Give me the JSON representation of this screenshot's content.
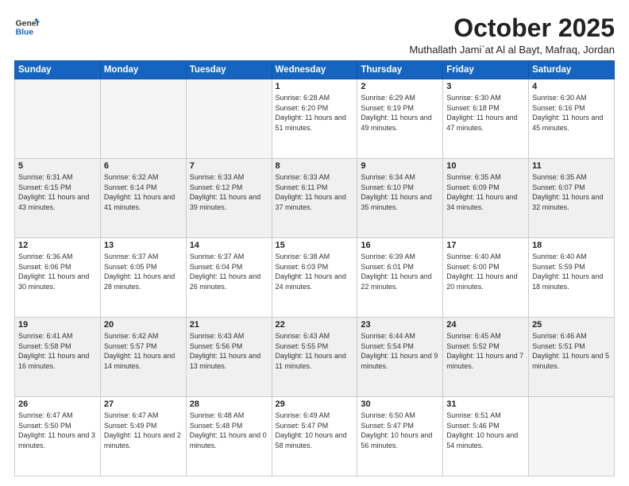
{
  "header": {
    "logo_general": "General",
    "logo_blue": "Blue",
    "month": "October 2025",
    "location": "Muthallath Jami`at Al al Bayt, Mafraq, Jordan"
  },
  "weekdays": [
    "Sunday",
    "Monday",
    "Tuesday",
    "Wednesday",
    "Thursday",
    "Friday",
    "Saturday"
  ],
  "weeks": [
    [
      {
        "day": "",
        "empty": true
      },
      {
        "day": "",
        "empty": true
      },
      {
        "day": "",
        "empty": true
      },
      {
        "day": "1",
        "sunrise": "Sunrise: 6:28 AM",
        "sunset": "Sunset: 6:20 PM",
        "daylight": "Daylight: 11 hours and 51 minutes."
      },
      {
        "day": "2",
        "sunrise": "Sunrise: 6:29 AM",
        "sunset": "Sunset: 6:19 PM",
        "daylight": "Daylight: 11 hours and 49 minutes."
      },
      {
        "day": "3",
        "sunrise": "Sunrise: 6:30 AM",
        "sunset": "Sunset: 6:18 PM",
        "daylight": "Daylight: 11 hours and 47 minutes."
      },
      {
        "day": "4",
        "sunrise": "Sunrise: 6:30 AM",
        "sunset": "Sunset: 6:16 PM",
        "daylight": "Daylight: 11 hours and 45 minutes."
      }
    ],
    [
      {
        "day": "5",
        "sunrise": "Sunrise: 6:31 AM",
        "sunset": "Sunset: 6:15 PM",
        "daylight": "Daylight: 11 hours and 43 minutes."
      },
      {
        "day": "6",
        "sunrise": "Sunrise: 6:32 AM",
        "sunset": "Sunset: 6:14 PM",
        "daylight": "Daylight: 11 hours and 41 minutes."
      },
      {
        "day": "7",
        "sunrise": "Sunrise: 6:33 AM",
        "sunset": "Sunset: 6:12 PM",
        "daylight": "Daylight: 11 hours and 39 minutes."
      },
      {
        "day": "8",
        "sunrise": "Sunrise: 6:33 AM",
        "sunset": "Sunset: 6:11 PM",
        "daylight": "Daylight: 11 hours and 37 minutes."
      },
      {
        "day": "9",
        "sunrise": "Sunrise: 6:34 AM",
        "sunset": "Sunset: 6:10 PM",
        "daylight": "Daylight: 11 hours and 35 minutes."
      },
      {
        "day": "10",
        "sunrise": "Sunrise: 6:35 AM",
        "sunset": "Sunset: 6:09 PM",
        "daylight": "Daylight: 11 hours and 34 minutes."
      },
      {
        "day": "11",
        "sunrise": "Sunrise: 6:35 AM",
        "sunset": "Sunset: 6:07 PM",
        "daylight": "Daylight: 11 hours and 32 minutes."
      }
    ],
    [
      {
        "day": "12",
        "sunrise": "Sunrise: 6:36 AM",
        "sunset": "Sunset: 6:06 PM",
        "daylight": "Daylight: 11 hours and 30 minutes."
      },
      {
        "day": "13",
        "sunrise": "Sunrise: 6:37 AM",
        "sunset": "Sunset: 6:05 PM",
        "daylight": "Daylight: 11 hours and 28 minutes."
      },
      {
        "day": "14",
        "sunrise": "Sunrise: 6:37 AM",
        "sunset": "Sunset: 6:04 PM",
        "daylight": "Daylight: 11 hours and 26 minutes."
      },
      {
        "day": "15",
        "sunrise": "Sunrise: 6:38 AM",
        "sunset": "Sunset: 6:03 PM",
        "daylight": "Daylight: 11 hours and 24 minutes."
      },
      {
        "day": "16",
        "sunrise": "Sunrise: 6:39 AM",
        "sunset": "Sunset: 6:01 PM",
        "daylight": "Daylight: 11 hours and 22 minutes."
      },
      {
        "day": "17",
        "sunrise": "Sunrise: 6:40 AM",
        "sunset": "Sunset: 6:00 PM",
        "daylight": "Daylight: 11 hours and 20 minutes."
      },
      {
        "day": "18",
        "sunrise": "Sunrise: 6:40 AM",
        "sunset": "Sunset: 5:59 PM",
        "daylight": "Daylight: 11 hours and 18 minutes."
      }
    ],
    [
      {
        "day": "19",
        "sunrise": "Sunrise: 6:41 AM",
        "sunset": "Sunset: 5:58 PM",
        "daylight": "Daylight: 11 hours and 16 minutes."
      },
      {
        "day": "20",
        "sunrise": "Sunrise: 6:42 AM",
        "sunset": "Sunset: 5:57 PM",
        "daylight": "Daylight: 11 hours and 14 minutes."
      },
      {
        "day": "21",
        "sunrise": "Sunrise: 6:43 AM",
        "sunset": "Sunset: 5:56 PM",
        "daylight": "Daylight: 11 hours and 13 minutes."
      },
      {
        "day": "22",
        "sunrise": "Sunrise: 6:43 AM",
        "sunset": "Sunset: 5:55 PM",
        "daylight": "Daylight: 11 hours and 11 minutes."
      },
      {
        "day": "23",
        "sunrise": "Sunrise: 6:44 AM",
        "sunset": "Sunset: 5:54 PM",
        "daylight": "Daylight: 11 hours and 9 minutes."
      },
      {
        "day": "24",
        "sunrise": "Sunrise: 6:45 AM",
        "sunset": "Sunset: 5:52 PM",
        "daylight": "Daylight: 11 hours and 7 minutes."
      },
      {
        "day": "25",
        "sunrise": "Sunrise: 6:46 AM",
        "sunset": "Sunset: 5:51 PM",
        "daylight": "Daylight: 11 hours and 5 minutes."
      }
    ],
    [
      {
        "day": "26",
        "sunrise": "Sunrise: 6:47 AM",
        "sunset": "Sunset: 5:50 PM",
        "daylight": "Daylight: 11 hours and 3 minutes."
      },
      {
        "day": "27",
        "sunrise": "Sunrise: 6:47 AM",
        "sunset": "Sunset: 5:49 PM",
        "daylight": "Daylight: 11 hours and 2 minutes."
      },
      {
        "day": "28",
        "sunrise": "Sunrise: 6:48 AM",
        "sunset": "Sunset: 5:48 PM",
        "daylight": "Daylight: 11 hours and 0 minutes."
      },
      {
        "day": "29",
        "sunrise": "Sunrise: 6:49 AM",
        "sunset": "Sunset: 5:47 PM",
        "daylight": "Daylight: 10 hours and 58 minutes."
      },
      {
        "day": "30",
        "sunrise": "Sunrise: 6:50 AM",
        "sunset": "Sunset: 5:47 PM",
        "daylight": "Daylight: 10 hours and 56 minutes."
      },
      {
        "day": "31",
        "sunrise": "Sunrise: 6:51 AM",
        "sunset": "Sunset: 5:46 PM",
        "daylight": "Daylight: 10 hours and 54 minutes."
      },
      {
        "day": "",
        "empty": true
      }
    ]
  ]
}
